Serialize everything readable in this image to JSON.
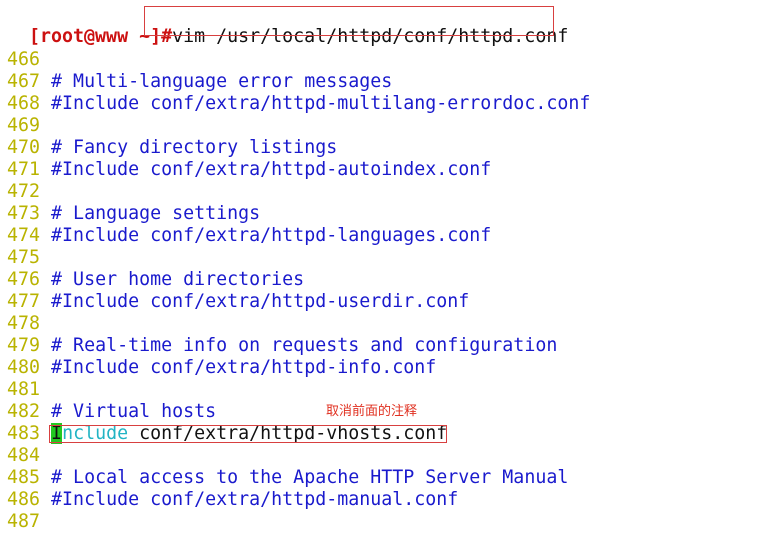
{
  "terminal": {
    "prompt": "[root@www ~]#",
    "command": "vim /usr/local/httpd/conf/httpd.conf"
  },
  "lines": [
    {
      "num": "466",
      "text": ""
    },
    {
      "num": "467",
      "text": "# Multi-language error messages"
    },
    {
      "num": "468",
      "text": "#Include conf/extra/httpd-multilang-errordoc.conf"
    },
    {
      "num": "469",
      "text": ""
    },
    {
      "num": "470",
      "text": "# Fancy directory listings"
    },
    {
      "num": "471",
      "text": "#Include conf/extra/httpd-autoindex.conf"
    },
    {
      "num": "472",
      "text": ""
    },
    {
      "num": "473",
      "text": "# Language settings"
    },
    {
      "num": "474",
      "text": "#Include conf/extra/httpd-languages.conf"
    },
    {
      "num": "475",
      "text": ""
    },
    {
      "num": "476",
      "text": "# User home directories"
    },
    {
      "num": "477",
      "text": "#Include conf/extra/httpd-userdir.conf"
    },
    {
      "num": "478",
      "text": ""
    },
    {
      "num": "479",
      "text": "# Real-time info on requests and configuration"
    },
    {
      "num": "480",
      "text": "#Include conf/extra/httpd-info.conf"
    },
    {
      "num": "481",
      "text": ""
    },
    {
      "num": "482",
      "text": "# Virtual hosts"
    },
    {
      "num": "483",
      "cursor": "I",
      "keyword_rest": "nclude",
      "rest": " conf/extra/httpd-vhosts.conf"
    },
    {
      "num": "484",
      "text": ""
    },
    {
      "num": "485",
      "text": "# Local access to the Apache HTTP Server Manual"
    },
    {
      "num": "486",
      "text": "#Include conf/extra/httpd-manual.conf"
    },
    {
      "num": "487",
      "text": ""
    }
  ],
  "annotation": {
    "note": "取消前面的注释",
    "box_color": "#d84040"
  },
  "colors": {
    "line_number": "#b9b300",
    "comment": "#1a1acd",
    "prompt": "#cc1111",
    "keyword": "#22b4c4",
    "cursor": "#22c922"
  }
}
